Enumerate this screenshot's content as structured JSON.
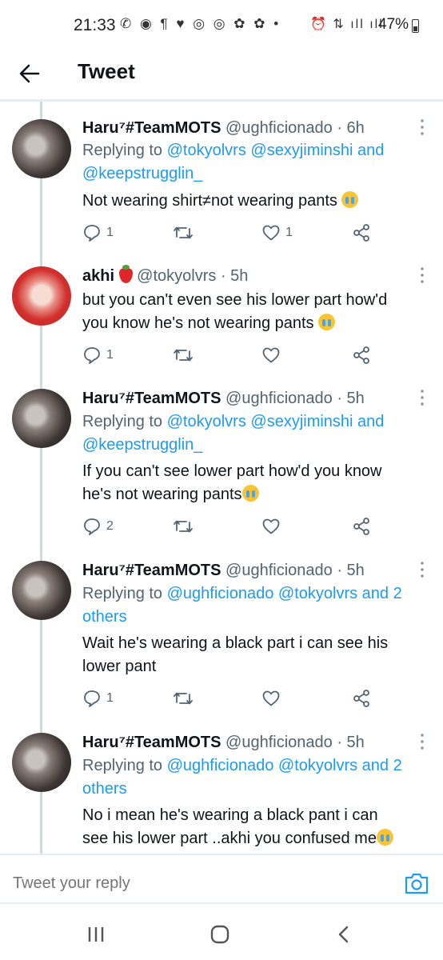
{
  "status_bar": {
    "time": "21:33",
    "left_icons": "✆ ◉ ¶ ♥ ◎ ◎ ✿ ✿ •",
    "right_icons": "⏰ ⇅ ıll ıll",
    "battery": "47%"
  },
  "header": {
    "title": "Tweet",
    "back_icon": "arrow-left-icon"
  },
  "tweets": [
    {
      "name": "Haru⁷#TeamMOTS",
      "handle": "@ughficionado",
      "time": "· 6h",
      "reply_prefix": "Replying to",
      "mentions_line1": "@tokyolvrs @sexyjiminshi and",
      "mentions_line2": "@keepstrugglin_",
      "text": "Not wearing shirt≠not wearing pants",
      "replies": "1",
      "retweets": "",
      "likes": "1"
    },
    {
      "name": "akhi",
      "handle": "@tokyolvrs",
      "time": "· 5h",
      "text_line1": "but you can't even see his lower part how'd",
      "text_line2": "you know he's not wearing pants",
      "replies": "1",
      "retweets": "",
      "likes": ""
    },
    {
      "name": "Haru⁷#TeamMOTS",
      "handle": "@ughficionado",
      "time": "· 5h",
      "reply_prefix": "Replying to",
      "mentions_line1": "@tokyolvrs @sexyjiminshi and",
      "mentions_line2": "@keepstrugglin_",
      "text_line1": "If you can't see lower part how'd you know",
      "text_line2": "he's not wearing pants",
      "replies": "2",
      "retweets": "",
      "likes": ""
    },
    {
      "name": "Haru⁷#TeamMOTS",
      "handle": "@ughficionado",
      "time": "· 5h",
      "reply_prefix": "Replying to",
      "mentions_line1": "@ughficionado @tokyolvrs and 2",
      "mentions_line2": "others",
      "text_line1": "Wait he's wearing a black part i can see his",
      "text_line2": "lower pant",
      "replies": "1",
      "retweets": "",
      "likes": ""
    },
    {
      "name": "Haru⁷#TeamMOTS",
      "handle": "@ughficionado",
      "time": "· 5h",
      "reply_prefix": "Replying to",
      "mentions_line1": "@ughficionado @tokyolvrs and 2",
      "mentions_line2": "others",
      "text_line1": "No i mean he's wearing a black pant i can",
      "text_line2": "see his lower part ..akhi you confused me"
    }
  ],
  "reply_bar": {
    "placeholder": "Tweet your reply"
  },
  "colors": {
    "accent": "#1d9bf0",
    "secondary_text": "#536471",
    "primary_text": "#0f1419",
    "divider": "#e6ecf0"
  }
}
